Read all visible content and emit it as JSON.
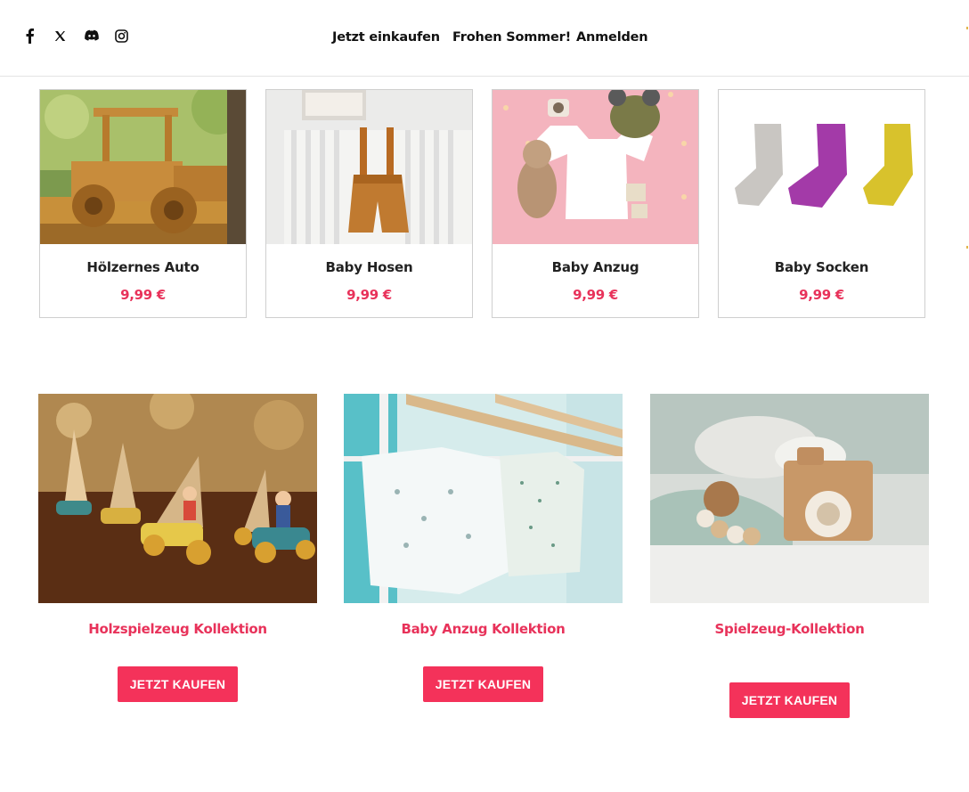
{
  "header": {
    "social": [
      {
        "name": "facebook-icon"
      },
      {
        "name": "x-twitter-icon"
      },
      {
        "name": "discord-icon"
      },
      {
        "name": "instagram-icon"
      }
    ],
    "nav": [
      "Jetzt einkaufen",
      "Frohen Sommer!",
      "Anmelden"
    ]
  },
  "products": [
    {
      "name": "Hölzernes Auto",
      "price": "9,99 €"
    },
    {
      "name": "Baby Hosen",
      "price": "9,99 €"
    },
    {
      "name": "Baby Anzug",
      "price": "9,99 €"
    },
    {
      "name": "Baby Socken",
      "price": "9,99 €"
    }
  ],
  "collections": [
    {
      "title": "Holzspielzeug Kollektion",
      "button": "JETZT KAUFEN"
    },
    {
      "title": "Baby Anzug Kollektion",
      "button": "JETZT KAUFEN"
    },
    {
      "title": "Spielzeug-Kollektion",
      "button": "JETZT KAUFEN"
    }
  ],
  "colors": {
    "accent": "#f4325a",
    "price": "#e8325a",
    "border": "#cfcfcf"
  }
}
